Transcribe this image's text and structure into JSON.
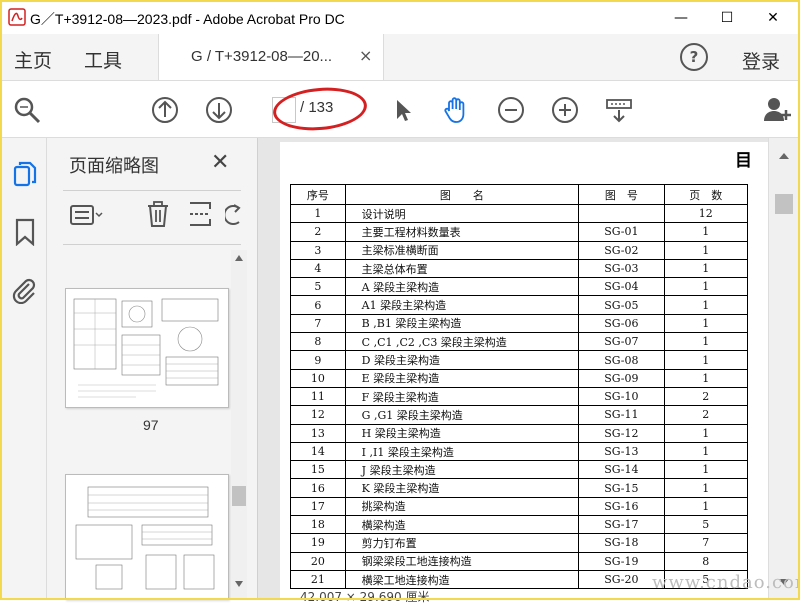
{
  "window": {
    "title": "G／T+3912-08—2023.pdf - Adobe Acrobat Pro DC",
    "logo_text": "汽",
    "minimize": "—",
    "maximize": "☐",
    "close": "✕"
  },
  "menubar": {
    "home": "主页",
    "tools": "工具",
    "tab_label": "G / T+3912-08—20...",
    "tab_close": "×",
    "help": "?",
    "login": "登录"
  },
  "toolbar": {
    "page_current": "",
    "page_total": "/ 133"
  },
  "thumbnails": {
    "title": "页面缩略图",
    "close": "✕",
    "page_label": "97"
  },
  "document": {
    "heading": "目",
    "headers": [
      "序号",
      "图　　名",
      "图　号",
      "页　数"
    ],
    "rows": [
      [
        "1",
        "设计说明",
        "",
        "12"
      ],
      [
        "2",
        "主要工程材料数量表",
        "SG-01",
        "1"
      ],
      [
        "3",
        "主梁标准横断面",
        "SG-02",
        "1"
      ],
      [
        "4",
        "主梁总体布置",
        "SG-03",
        "1"
      ],
      [
        "5",
        "A 梁段主梁构造",
        "SG-04",
        "1"
      ],
      [
        "6",
        "A1 梁段主梁构造",
        "SG-05",
        "1"
      ],
      [
        "7",
        "B ,B1 梁段主梁构造",
        "SG-06",
        "1"
      ],
      [
        "8",
        "C ,C1 ,C2 ,C3 梁段主梁构造",
        "SG-07",
        "1"
      ],
      [
        "9",
        "D 梁段主梁构造",
        "SG-08",
        "1"
      ],
      [
        "10",
        "E 梁段主梁构造",
        "SG-09",
        "1"
      ],
      [
        "11",
        "F 梁段主梁构造",
        "SG-10",
        "2"
      ],
      [
        "12",
        "G ,G1 梁段主梁构造",
        "SG-11",
        "2"
      ],
      [
        "13",
        "H 梁段主梁构造",
        "SG-12",
        "1"
      ],
      [
        "14",
        "I ,I1 梁段主梁构造",
        "SG-13",
        "1"
      ],
      [
        "15",
        "J 梁段主梁构造",
        "SG-14",
        "1"
      ],
      [
        "16",
        "K 梁段主梁构造",
        "SG-15",
        "1"
      ],
      [
        "17",
        "挑梁构造",
        "SG-16",
        "1"
      ],
      [
        "18",
        "横梁构造",
        "SG-17",
        "5"
      ],
      [
        "19",
        "剪力钉布置",
        "SG-18",
        "7"
      ],
      [
        "20",
        "钢梁梁段工地连接构造",
        "SG-19",
        "8"
      ],
      [
        "21",
        "横梁工地连接构造",
        "SG-20",
        "5"
      ]
    ],
    "status": "42.007 × 29.690 厘米"
  },
  "watermark": "www.cndao.com"
}
